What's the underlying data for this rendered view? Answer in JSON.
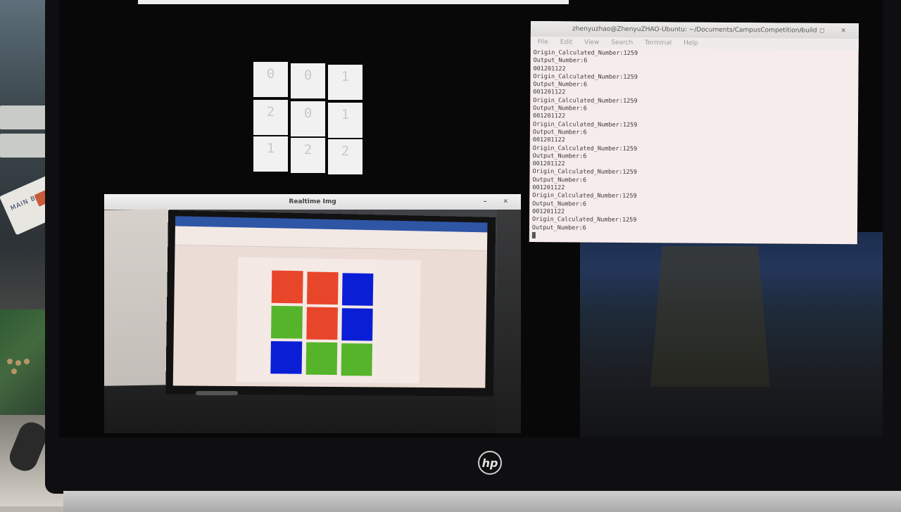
{
  "photo": {
    "description_free": true
  },
  "terminal": {
    "title": "zhenyuzhao@ZhenyuZHAO-Ubuntu: ~/Documents/CampusCompetition/build",
    "window_buttons": "– ◻ ✕",
    "menu": [
      "File",
      "Edit",
      "View",
      "Search",
      "Terminal",
      "Help"
    ],
    "lines": [
      "Origin_Calculated_Number:1259",
      "Output_Number:6",
      "001201122",
      "Origin_Calculated_Number:1259",
      "Output_Number:6",
      "001201122",
      "Origin_Calculated_Number:1259",
      "Output_Number:6",
      "001201122",
      "Origin_Calculated_Number:1259",
      "Output_Number:6",
      "001201122",
      "Origin_Calculated_Number:1259",
      "Output_Number:6",
      "001201122",
      "Origin_Calculated_Number:1259",
      "Output_Number:6",
      "001201122",
      "Origin_Calculated_Number:1259",
      "Output_Number:6",
      "001201122",
      "Origin_Calculated_Number:1259",
      "Output_Number:6"
    ]
  },
  "digit_grid": {
    "digits": [
      "0",
      "0",
      "1",
      "2",
      "0",
      "1",
      "1",
      "2",
      "2"
    ]
  },
  "realtime_window": {
    "title": "Realtime Img",
    "window_buttons": "– ✕",
    "tile_colors": [
      "#e8462a",
      "#e8462a",
      "#0a1ed6",
      "#55b42a",
      "#e8462a",
      "#0a1ed6",
      "#0a1ed6",
      "#55b42a",
      "#55b42a"
    ]
  },
  "desk": {
    "board_label": "MAIN BIT"
  },
  "laptop": {
    "logo": "hp"
  }
}
